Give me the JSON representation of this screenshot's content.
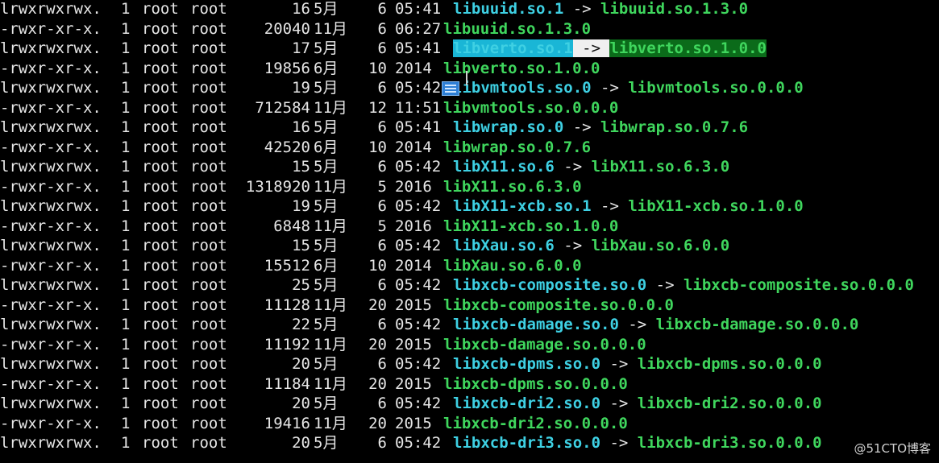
{
  "rows": [
    {
      "perm": "lrwxrwxrwx.",
      "links": "1",
      "owner": "root",
      "group": "root",
      "size": "16",
      "month": "5月",
      "day": "6",
      "time": "05:41",
      "name": "libuuid.so.1",
      "arrow": "->",
      "target": "libuuid.so.1.3.0"
    },
    {
      "perm": "-rwxr-xr-x.",
      "links": "1",
      "owner": "root",
      "group": "root",
      "size": "20040",
      "month": "11月",
      "day": "6",
      "time": "06:27",
      "name": "libuuid.so.1.3.0",
      "arrow": "",
      "target": ""
    },
    {
      "perm": "lrwxrwxrwx.",
      "links": "1",
      "owner": "root",
      "group": "root",
      "size": "17",
      "month": "5月",
      "day": "6",
      "time": "05:41",
      "name": "libverto.so.1",
      "arrow": "->",
      "target": "libverto.so.1.0.0",
      "selected": true
    },
    {
      "perm": "-rwxr-xr-x.",
      "links": "1",
      "owner": "root",
      "group": "root",
      "size": "19856",
      "month": "6月",
      "day": "10",
      "time": "2014",
      "name": "libverto.so.1.0.0",
      "arrow": "",
      "target": ""
    },
    {
      "perm": "lrwxrwxrwx.",
      "links": "1",
      "owner": "root",
      "group": "root",
      "size": "19",
      "month": "5月",
      "day": "6",
      "time": "05:42",
      "name": "libvmtools.so.0",
      "arrow": "->",
      "target": "libvmtools.so.0.0.0"
    },
    {
      "perm": "-rwxr-xr-x.",
      "links": "1",
      "owner": "root",
      "group": "root",
      "size": "712584",
      "month": "11月",
      "day": "12",
      "time": "11:51",
      "name": "libvmtools.so.0.0.0",
      "arrow": "",
      "target": ""
    },
    {
      "perm": "lrwxrwxrwx.",
      "links": "1",
      "owner": "root",
      "group": "root",
      "size": "16",
      "month": "5月",
      "day": "6",
      "time": "05:41",
      "name": "libwrap.so.0",
      "arrow": "->",
      "target": "libwrap.so.0.7.6"
    },
    {
      "perm": "-rwxr-xr-x.",
      "links": "1",
      "owner": "root",
      "group": "root",
      "size": "42520",
      "month": "6月",
      "day": "10",
      "time": "2014",
      "name": "libwrap.so.0.7.6",
      "arrow": "",
      "target": ""
    },
    {
      "perm": "lrwxrwxrwx.",
      "links": "1",
      "owner": "root",
      "group": "root",
      "size": "15",
      "month": "5月",
      "day": "6",
      "time": "05:42",
      "name": "libX11.so.6",
      "arrow": "->",
      "target": "libX11.so.6.3.0"
    },
    {
      "perm": "-rwxr-xr-x.",
      "links": "1",
      "owner": "root",
      "group": "root",
      "size": "1318920",
      "month": "11月",
      "day": "5",
      "time": "2016",
      "name": "libX11.so.6.3.0",
      "arrow": "",
      "target": ""
    },
    {
      "perm": "lrwxrwxrwx.",
      "links": "1",
      "owner": "root",
      "group": "root",
      "size": "19",
      "month": "5月",
      "day": "6",
      "time": "05:42",
      "name": "libX11-xcb.so.1",
      "arrow": "->",
      "target": "libX11-xcb.so.1.0.0"
    },
    {
      "perm": "-rwxr-xr-x.",
      "links": "1",
      "owner": "root",
      "group": "root",
      "size": "6848",
      "month": "11月",
      "day": "5",
      "time": "2016",
      "name": "libX11-xcb.so.1.0.0",
      "arrow": "",
      "target": ""
    },
    {
      "perm": "lrwxrwxrwx.",
      "links": "1",
      "owner": "root",
      "group": "root",
      "size": "15",
      "month": "5月",
      "day": "6",
      "time": "05:42",
      "name": "libXau.so.6",
      "arrow": "->",
      "target": "libXau.so.6.0.0"
    },
    {
      "perm": "-rwxr-xr-x.",
      "links": "1",
      "owner": "root",
      "group": "root",
      "size": "15512",
      "month": "6月",
      "day": "10",
      "time": "2014",
      "name": "libXau.so.6.0.0",
      "arrow": "",
      "target": ""
    },
    {
      "perm": "lrwxrwxrwx.",
      "links": "1",
      "owner": "root",
      "group": "root",
      "size": "25",
      "month": "5月",
      "day": "6",
      "time": "05:42",
      "name": "libxcb-composite.so.0",
      "arrow": "->",
      "target": "libxcb-composite.so.0.0.0"
    },
    {
      "perm": "-rwxr-xr-x.",
      "links": "1",
      "owner": "root",
      "group": "root",
      "size": "11128",
      "month": "11月",
      "day": "20",
      "time": "2015",
      "name": "libxcb-composite.so.0.0.0",
      "arrow": "",
      "target": ""
    },
    {
      "perm": "lrwxrwxrwx.",
      "links": "1",
      "owner": "root",
      "group": "root",
      "size": "22",
      "month": "5月",
      "day": "6",
      "time": "05:42",
      "name": "libxcb-damage.so.0",
      "arrow": "->",
      "target": "libxcb-damage.so.0.0.0"
    },
    {
      "perm": "-rwxr-xr-x.",
      "links": "1",
      "owner": "root",
      "group": "root",
      "size": "11192",
      "month": "11月",
      "day": "20",
      "time": "2015",
      "name": "libxcb-damage.so.0.0.0",
      "arrow": "",
      "target": ""
    },
    {
      "perm": "lrwxrwxrwx.",
      "links": "1",
      "owner": "root",
      "group": "root",
      "size": "20",
      "month": "5月",
      "day": "6",
      "time": "05:42",
      "name": "libxcb-dpms.so.0",
      "arrow": "->",
      "target": "libxcb-dpms.so.0.0.0"
    },
    {
      "perm": "-rwxr-xr-x.",
      "links": "1",
      "owner": "root",
      "group": "root",
      "size": "11184",
      "month": "11月",
      "day": "20",
      "time": "2015",
      "name": "libxcb-dpms.so.0.0.0",
      "arrow": "",
      "target": ""
    },
    {
      "perm": "lrwxrwxrwx.",
      "links": "1",
      "owner": "root",
      "group": "root",
      "size": "20",
      "month": "5月",
      "day": "6",
      "time": "05:42",
      "name": "libxcb-dri2.so.0",
      "arrow": "->",
      "target": "libxcb-dri2.so.0.0.0"
    },
    {
      "perm": "-rwxr-xr-x.",
      "links": "1",
      "owner": "root",
      "group": "root",
      "size": "19416",
      "month": "11月",
      "day": "20",
      "time": "2015",
      "name": "libxcb-dri2.so.0.0.0",
      "arrow": "",
      "target": ""
    },
    {
      "perm": "lrwxrwxrwx.",
      "links": "1",
      "owner": "root",
      "group": "root",
      "size": "20",
      "month": "5月",
      "day": "6",
      "time": "05:42",
      "name": "libxcb-dri3.so.0",
      "arrow": "->",
      "target": "libxcb-dri3.so.0.0.0"
    }
  ],
  "watermark": "@51CTO博客",
  "colors": {
    "background": "#000000",
    "text": "#e6e6e6",
    "symlink": "#3ed0e3",
    "regular": "#3fd65d"
  },
  "icons": [
    "file-drag-icon",
    "text-cursor-icon"
  ]
}
